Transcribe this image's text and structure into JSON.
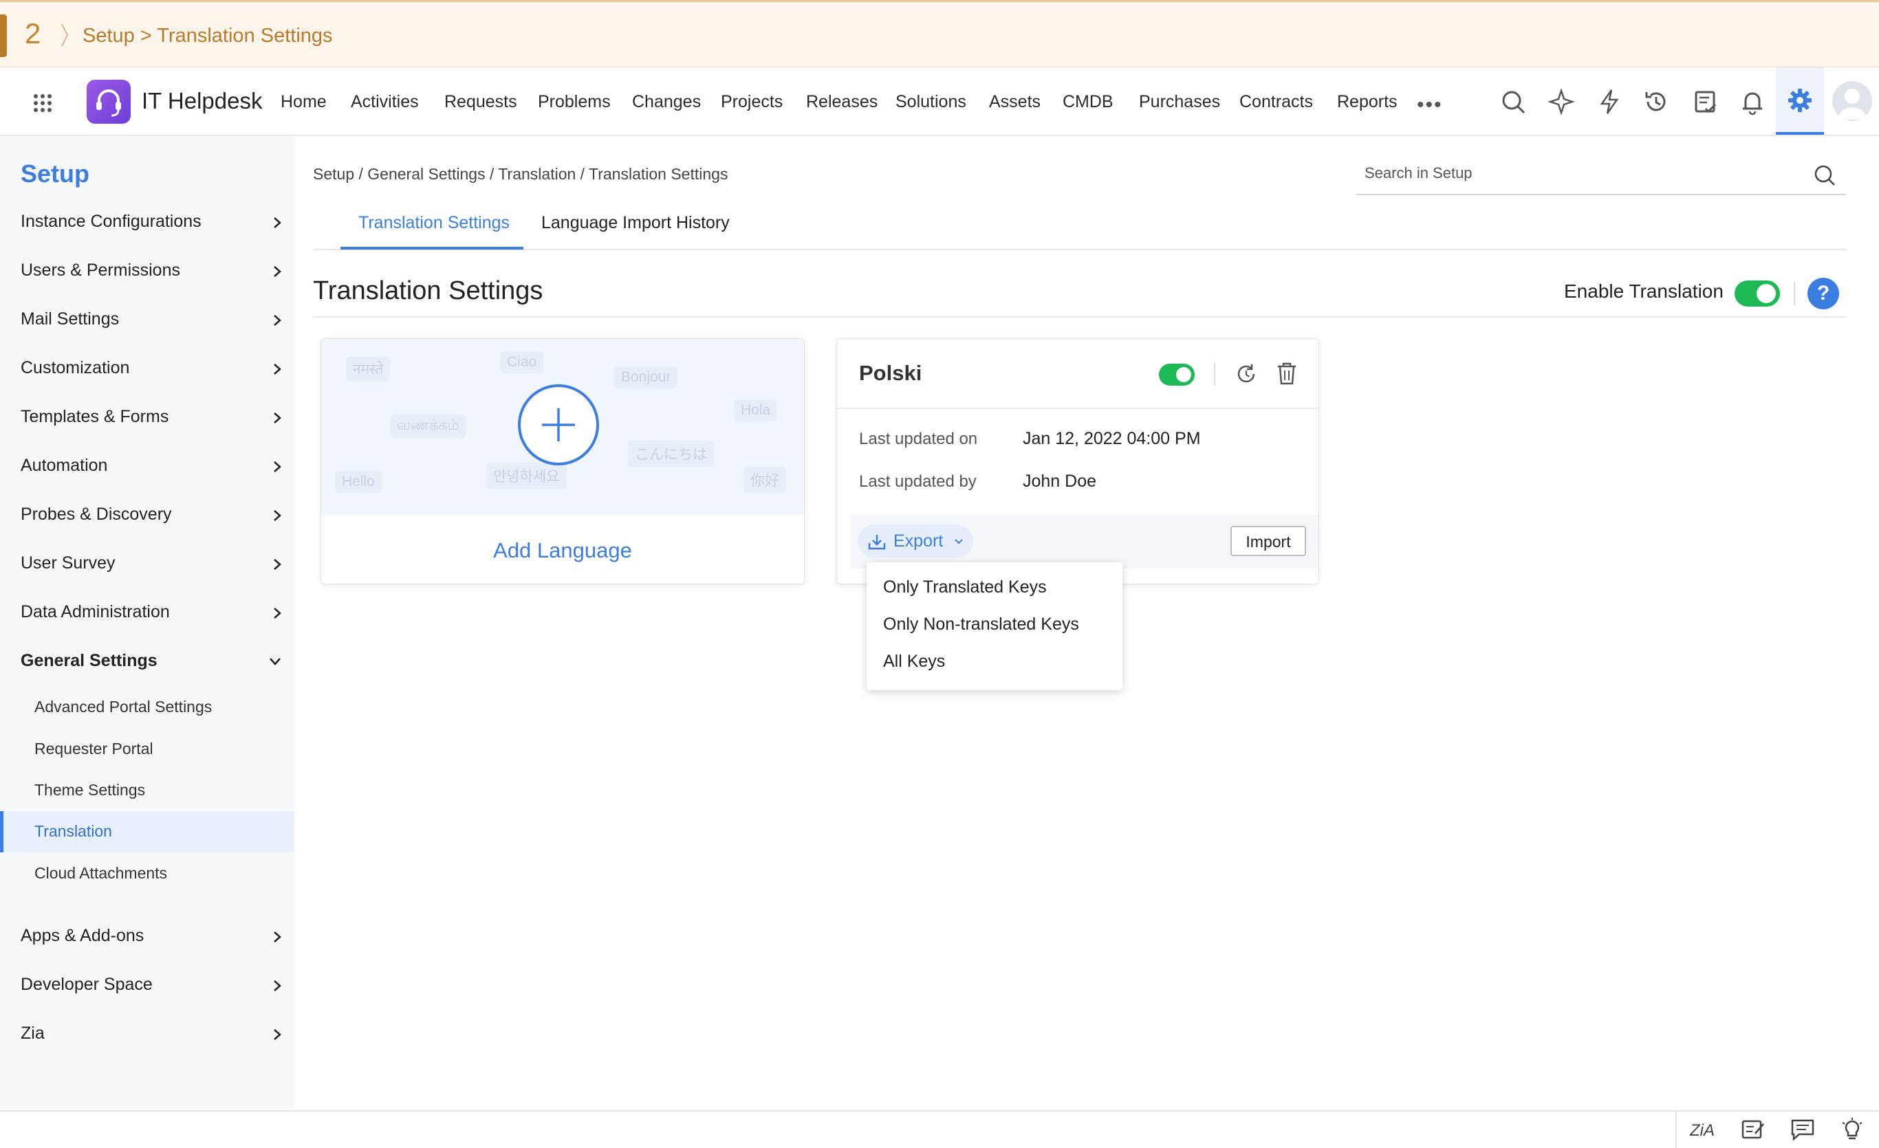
{
  "banner": {
    "step": "2",
    "path": "Setup > Translation Settings"
  },
  "navbar": {
    "brand": "IT Helpdesk",
    "items": [
      "Home",
      "Activities",
      "Requests",
      "Problems",
      "Changes",
      "Projects",
      "Releases",
      "Solutions",
      "Assets",
      "CMDB",
      "Purchases",
      "Contracts",
      "Reports"
    ],
    "more": "•••"
  },
  "sidebar": {
    "title": "Setup",
    "items": [
      {
        "label": "Instance Configurations"
      },
      {
        "label": "Users & Permissions"
      },
      {
        "label": "Mail Settings"
      },
      {
        "label": "Customization"
      },
      {
        "label": "Templates & Forms"
      },
      {
        "label": "Automation"
      },
      {
        "label": "Probes & Discovery"
      },
      {
        "label": "User Survey"
      },
      {
        "label": "Data Administration"
      },
      {
        "label": "General Settings"
      }
    ],
    "subitems": [
      "Advanced Portal Settings",
      "Requester Portal",
      "Theme Settings",
      "Translation",
      "Cloud Attachments"
    ],
    "after_items": [
      "Apps & Add-ons",
      "Developer Space",
      "Zia"
    ]
  },
  "main": {
    "breadcrumb": "Setup / General Settings / Translation / Translation Settings",
    "search_placeholder": "Search in Setup",
    "tabs": [
      "Translation Settings",
      "Language Import History"
    ],
    "title": "Translation Settings",
    "enable_label": "Enable Translation",
    "help": "?"
  },
  "add_card": {
    "words": [
      "नमस्ते",
      "Ciao",
      "Bonjour",
      "Hola",
      "வணக்கம்",
      "こんにちは",
      "안녕하세요",
      "你好",
      "Hello"
    ],
    "label": "Add Language"
  },
  "lang_card": {
    "name": "Polski",
    "updated_on_label": "Last updated on",
    "updated_on": "Jan 12, 2022 04:00 PM",
    "updated_by_label": "Last updated by",
    "updated_by": "John Doe",
    "export": "Export",
    "import": "Import"
  },
  "export_menu": [
    "Only Translated Keys",
    "Only Non-translated Keys",
    "All Keys"
  ],
  "colors": {
    "accent": "#3b7de0",
    "toggle_on": "#1cb955",
    "banner_bg": "#fcf5ec",
    "banner_text": "#b97a2a"
  }
}
